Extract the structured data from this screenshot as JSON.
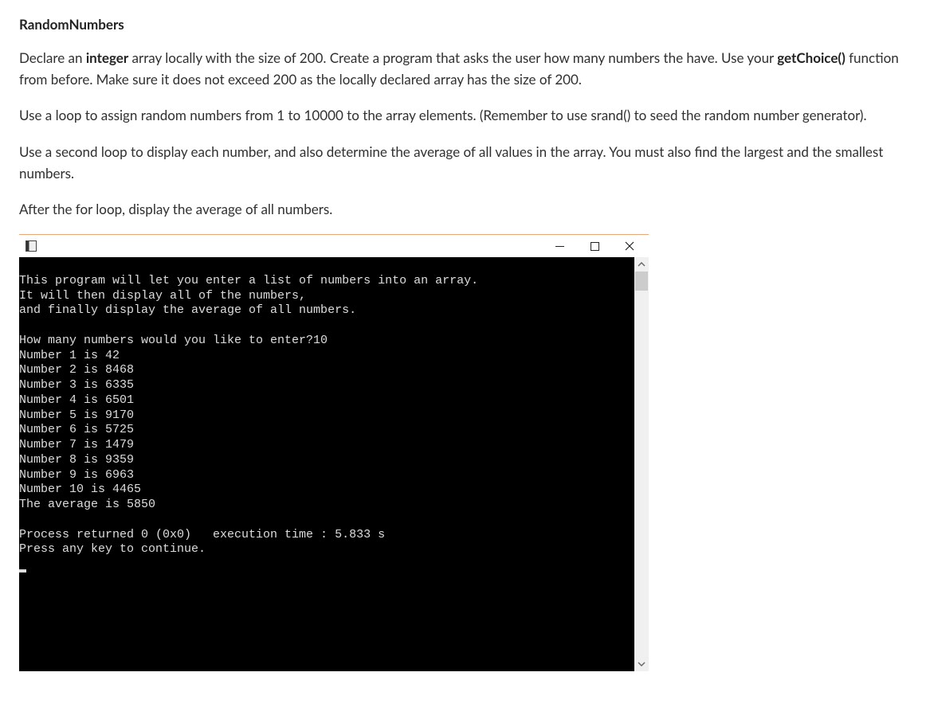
{
  "heading": "RandomNumbers",
  "p1_a": "Declare an ",
  "p1_b": "integer",
  "p1_c": " array locally with the size of 200. Create a program that asks the user how many numbers the have. Use your ",
  "p1_d": "getChoice()",
  "p1_e": " function from before. Make sure it does not exceed 200 as the locally declared array has the size of 200.",
  "p2": "Use a loop to assign random numbers from 1 to 10000 to the array elements. (Remember to use srand() to seed the random number generator).",
  "p3": "Use a second loop to display each number, and also determine the average of all values in the array. You must also find the largest and the smallest numbers.",
  "p4": "After the for loop, display the average of all numbers.",
  "console": {
    "intro1": "This program will let you enter a list of numbers into an array.",
    "intro2": "It will then display all of the numbers,",
    "intro3": "and finally display the average of all numbers.",
    "blank": "",
    "prompt": "How many numbers would you like to enter?10",
    "n1": "Number 1 is 42",
    "n2": "Number 2 is 8468",
    "n3": "Number 3 is 6335",
    "n4": "Number 4 is 6501",
    "n5": "Number 5 is 9170",
    "n6": "Number 6 is 5725",
    "n7": "Number 7 is 1479",
    "n8": "Number 8 is 9359",
    "n9": "Number 9 is 6963",
    "n10": "Number 10 is 4465",
    "avg": "The average is 5850",
    "proc": "Process returned 0 (0x0)   execution time : 5.833 s",
    "cont": "Press any key to continue."
  }
}
